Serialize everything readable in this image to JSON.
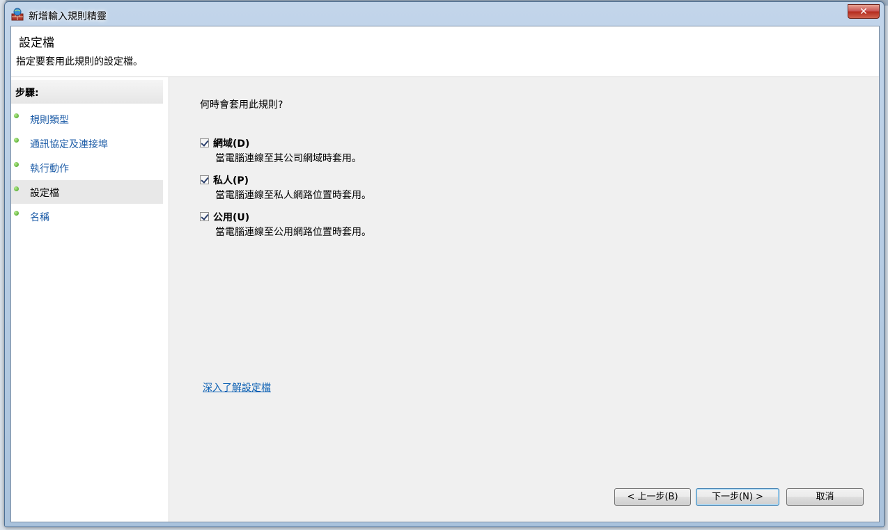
{
  "window": {
    "title": "新增輸入規則精靈",
    "close_symbol": "✕"
  },
  "header": {
    "title": "設定檔",
    "subtitle": "指定要套用此規則的設定檔。"
  },
  "sidebar": {
    "heading": "步驟:",
    "items": [
      {
        "label": "規則類型"
      },
      {
        "label": "通訊協定及連接埠"
      },
      {
        "label": "執行動作"
      },
      {
        "label": "設定檔"
      },
      {
        "label": "名稱"
      }
    ],
    "current_index": 3
  },
  "main": {
    "question": "何時會套用此規則?",
    "options": [
      {
        "label": "網域(D)",
        "description": "當電腦連線至其公司網域時套用。",
        "checked": true
      },
      {
        "label": "私人(P)",
        "description": "當電腦連線至私人網路位置時套用。",
        "checked": true
      },
      {
        "label": "公用(U)",
        "description": "當電腦連線至公用網路位置時套用。",
        "checked": true
      }
    ],
    "learn_more": "深入了解設定檔"
  },
  "buttons": {
    "back": "< 上一步(B)",
    "next": "下一步(N) >",
    "cancel": "取消"
  }
}
